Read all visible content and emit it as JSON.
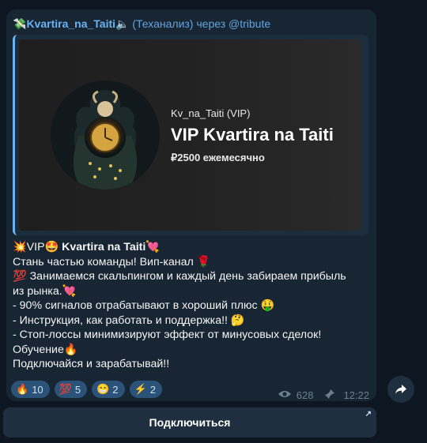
{
  "header": {
    "sender": "Kvartira_na_Taiti",
    "suffix": "(Теханализ)",
    "via": "через @tribute",
    "leading_emoji": "💸",
    "trailing_emoji": "🔈"
  },
  "card": {
    "handle": "Kv_na_Taiti (VIP)",
    "title": "VIP Kvartira na Taiti",
    "price": "₽2500 ежемесячно"
  },
  "message": {
    "line1_prefix": "💥VIP🤩 ",
    "line1_title": "Kvartira na Taiti",
    "line1_suffix": "💘",
    "line2": "Стань частью команды! Вип-канал 🌹",
    "line3": "💯 Занимаемся скальпингом и каждый день забираем прибыль",
    "line4": "из рынка.💘",
    "line5": "- 90% сигналов отрабатывают в хороший плюс 🤑",
    "line6": "- Инструкция, как работать и поддержка!! 🤔",
    "line7": "- Стоп-лоссы минимизируют эффект от минусовых сделок!",
    "line8": "Обучение🔥",
    "line9": "Подключайся и зарабатывай!!"
  },
  "reactions": [
    {
      "emoji": "🔥",
      "count": "10"
    },
    {
      "emoji": "💯",
      "count": "5"
    },
    {
      "emoji": "😁",
      "count": "2"
    },
    {
      "emoji": "⚡",
      "count": "2"
    }
  ],
  "meta": {
    "views": "628",
    "time": "12:22",
    "eye_icon": "eye-icon",
    "pin_icon": "pin-icon"
  },
  "button": {
    "label": "Подключиться",
    "arrow_icon": "↗"
  },
  "share_icon": "share-icon"
}
